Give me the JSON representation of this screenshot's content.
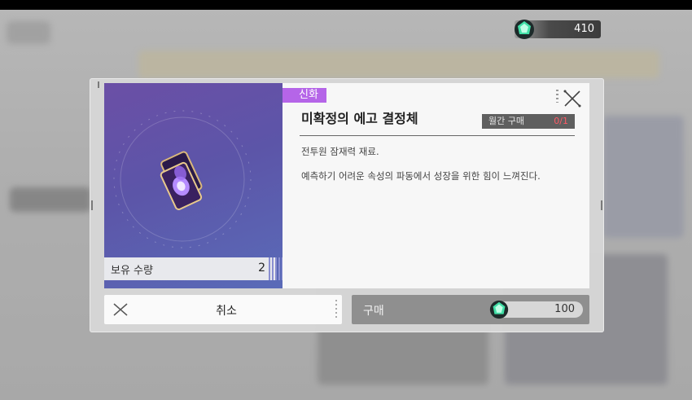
{
  "currency": {
    "icon": "crystal-gem-icon",
    "amount": "410"
  },
  "modal": {
    "rarity": "신화",
    "title": "미확정의 에고 결정체",
    "monthly_label": "월간 구매",
    "monthly_value": "0/1",
    "description_1": "전투원 잠재력 재료.",
    "description_2": "예측하기 어려운 속성의 파동에서 성장을 위한 힘이 느껴진다.",
    "owned_label": "보유 수량",
    "owned_value": "2",
    "cancel_label": "취소",
    "buy_label": "구매",
    "price": "100",
    "colors": {
      "rarity": "#b565e8",
      "limit": "#ff5a66",
      "art_start": "#6b4fa6",
      "art_end": "#5a6bb8"
    }
  }
}
